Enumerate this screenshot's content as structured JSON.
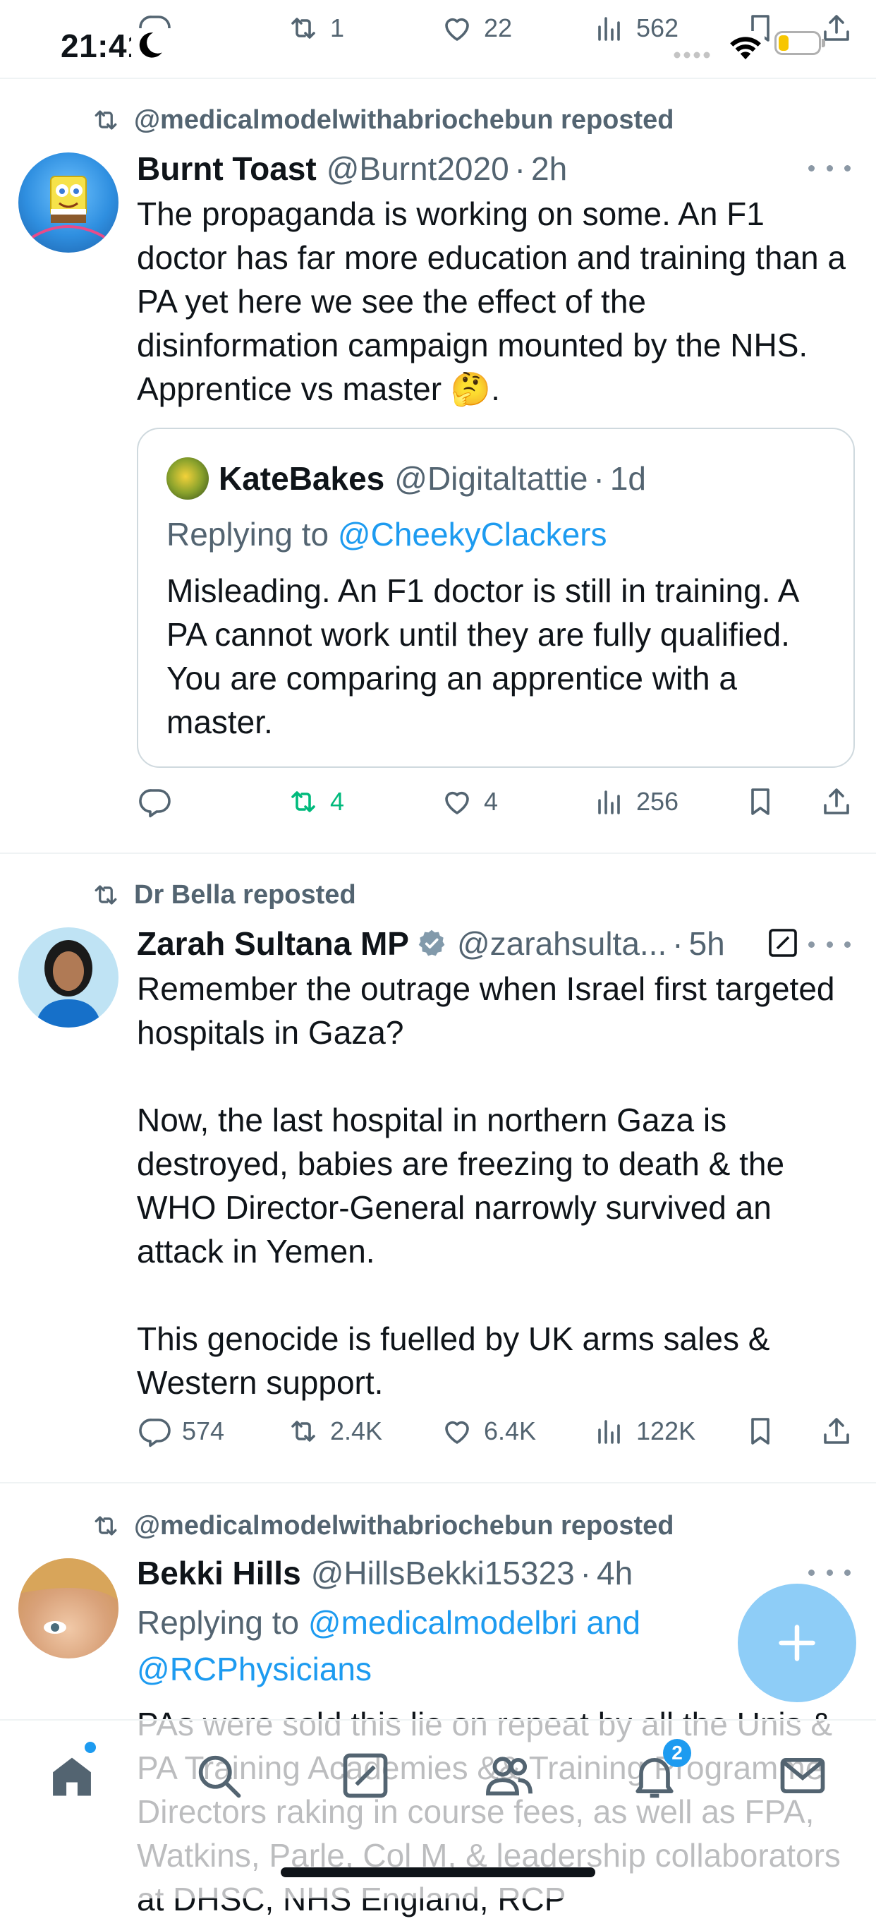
{
  "status_bar": {
    "time": "21:41"
  },
  "top_actions": {
    "replies": "",
    "reposts": "1",
    "likes": "22",
    "views": "562"
  },
  "tweets": [
    {
      "repost_by": "@medicalmodelwithabriochebun reposted",
      "name": "Burnt Toast",
      "handle": "@Burnt2020",
      "time": "2h",
      "text": "The propaganda is working on some. An F1 doctor has far more education and training than a PA yet here we see the effect of the disinformation campaign mounted by the NHS. Apprentice vs master 🤔.",
      "quote": {
        "name": "KateBakes",
        "handle": "@Digitaltattie",
        "time": "1d",
        "replying_prefix": "Replying to ",
        "replying_to": "@CheekyClackers",
        "text": "Misleading. An F1 doctor is still in training. A PA cannot work until they are fully qualified. You are comparing an apprentice with a master."
      },
      "stats": {
        "replies": "",
        "reposts": "4",
        "likes": "4",
        "views": "256"
      }
    },
    {
      "repost_by": "Dr Bella reposted",
      "name": "Zarah Sultana MP",
      "handle": "@zarahsulta...",
      "time": "5h",
      "text": "Remember the outrage when Israel first targeted hospitals in Gaza?\n\nNow, the last hospital in northern Gaza is destroyed, babies are freezing to death & the WHO Director-General narrowly survived an attack in Yemen.\n\nThis genocide is fuelled by UK arms sales & Western support.",
      "stats": {
        "replies": "574",
        "reposts": "2.4K",
        "likes": "6.4K",
        "views": "122K"
      }
    },
    {
      "repost_by": "@medicalmodelwithabriochebun reposted",
      "name": "Bekki Hills",
      "handle": "@HillsBekki15323",
      "time": "4h",
      "replying_prefix": "Replying to ",
      "replying_to_line1": "@medicalmodelbri and",
      "replying_to_line2": "@RCPhysicians",
      "text": "PAs were sold this lie on repeat by all the Unis & PA Training Academies && Training Programme Directors raking in course fees, as well as FPA, Watkins, Parle, Col M, & leadership collaborators at DHSC, NHS England, RCP"
    }
  ],
  "tab_bar": {
    "notifications_badge": "2"
  },
  "colors": {
    "accent": "#1d9bf0",
    "repost_green": "#00ba7c",
    "text": "#0f1419",
    "muted": "#536471"
  }
}
